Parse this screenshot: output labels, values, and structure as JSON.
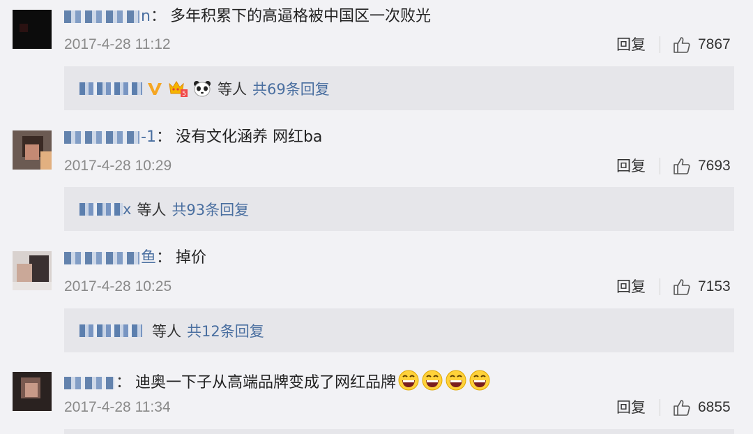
{
  "comments": [
    {
      "username_visible": "n",
      "text": "多年积累下的高逼格被中国区一次败光",
      "time": "2017-4-28 11:12",
      "reply_label": "回复",
      "likes": "7867",
      "replies": {
        "names_visible": "",
        "others": "等人",
        "count_text": "共69条回复"
      }
    },
    {
      "username_visible": "-1",
      "text": "没有文化涵养 网红ba",
      "time": "2017-4-28 10:29",
      "reply_label": "回复",
      "likes": "7693",
      "replies": {
        "names_visible": "x",
        "others": "等人",
        "count_text": "共93条回复"
      }
    },
    {
      "username_visible": "鱼",
      "text": "掉价",
      "time": "2017-4-28 10:25",
      "reply_label": "回复",
      "likes": "7153",
      "replies": {
        "names_visible": "",
        "others": "等人",
        "count_text": "共12条回复"
      }
    },
    {
      "username_visible": "",
      "text": "迪奥一下子从高端品牌变成了网红品牌",
      "time": "2017-4-28 11:34",
      "reply_label": "回复",
      "likes": "6855"
    }
  ],
  "icons": {
    "like": "thumbs-up-outline-icon",
    "verified": "v-badge-icon",
    "crown": "member-crown-icon",
    "panda": "panda-emoji-icon",
    "laugh": "laughing-emoji-icon"
  },
  "colors": {
    "background": "#f2f2f5",
    "reply_box": "#e6e6ea",
    "link": "#4a6fa0",
    "time": "#8a8a8a",
    "verified": "#f5a623"
  }
}
